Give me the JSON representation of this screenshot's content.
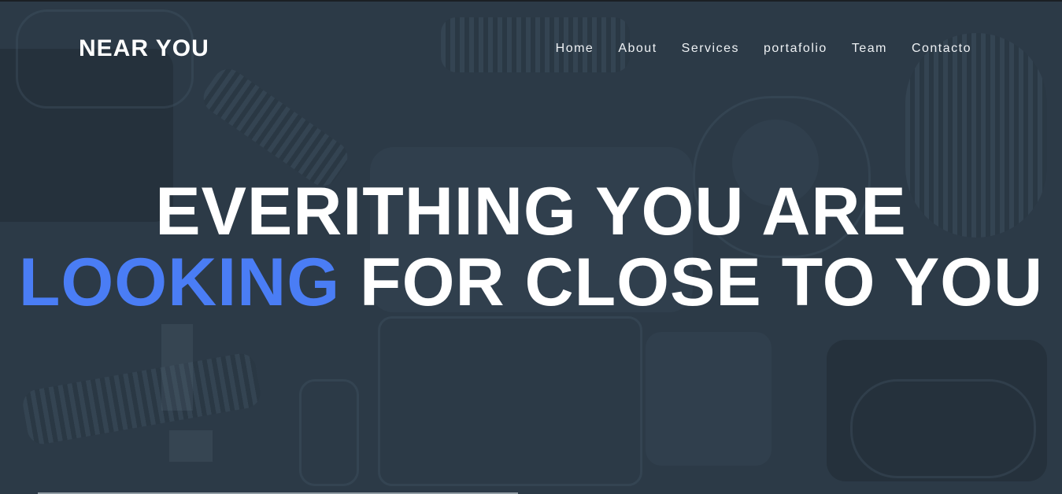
{
  "brand": {
    "name": "NEAR YOU"
  },
  "nav": {
    "items": [
      {
        "label": "Home"
      },
      {
        "label": "About"
      },
      {
        "label": "Services"
      },
      {
        "label": "portafolio"
      },
      {
        "label": "Team"
      },
      {
        "label": "Contacto"
      }
    ]
  },
  "hero": {
    "line1": "EVERITHING YOU ARE",
    "line2_accent": "LOOKING",
    "line2_rest": " FOR CLOSE TO YOU",
    "accent_color": "#4a7df5",
    "background_color": "#2c3a47"
  }
}
